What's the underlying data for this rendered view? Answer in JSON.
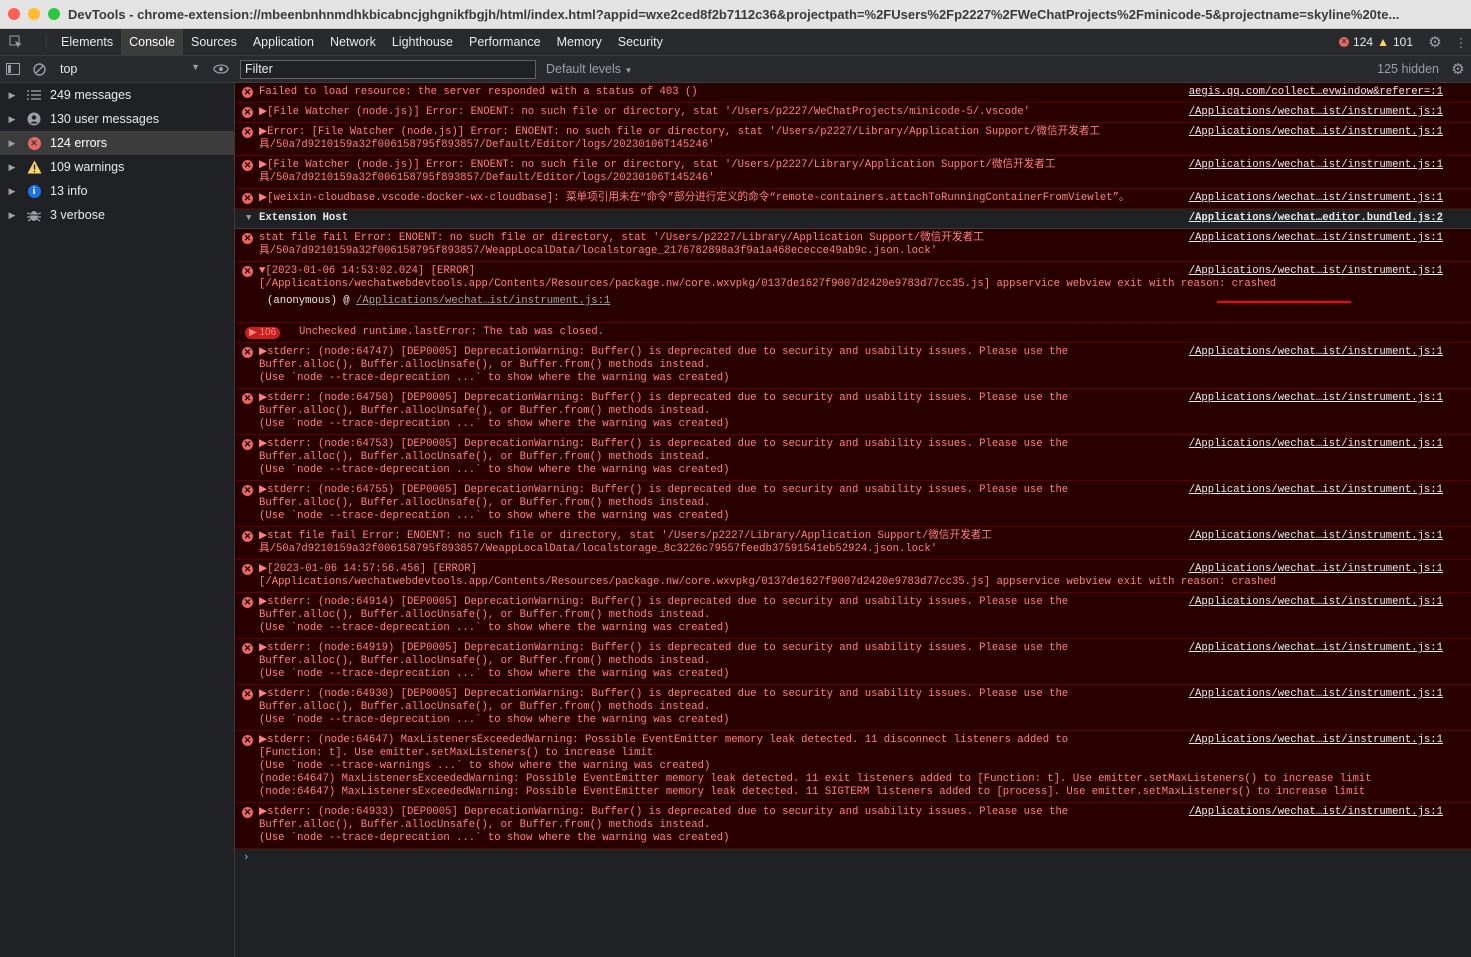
{
  "window": {
    "title": "DevTools - chrome-extension://mbeenbnhnmdhkbicabncjghgnikfbgjh/html/index.html?appid=wxe2ced8f2b7112c36&projectpath=%2FUsers%2Fp2227%2FWeChatProjects%2Fminicode-5&projectname=skyline%20te..."
  },
  "tabs": [
    "Elements",
    "Console",
    "Sources",
    "Application",
    "Network",
    "Lighthouse",
    "Performance",
    "Memory",
    "Security"
  ],
  "status": {
    "errors": "124",
    "warnings": "101"
  },
  "toolbar": {
    "context": "top",
    "filter_placeholder": "Filter",
    "levels": "Default levels",
    "hidden": "125 hidden"
  },
  "sidebar": [
    {
      "label": "249 messages",
      "icon": "list-icon"
    },
    {
      "label": "130 user messages",
      "icon": "user-icon"
    },
    {
      "label": "124 errors",
      "icon": "error-icon"
    },
    {
      "label": "109 warnings",
      "icon": "warning-icon"
    },
    {
      "label": "13 info",
      "icon": "info-icon"
    },
    {
      "label": "3 verbose",
      "icon": "bug-icon"
    }
  ],
  "messages": [
    {
      "text": "Failed to load resource: the server responded with a status of 403 ()",
      "source": "aegis.qq.com/collect…evwindow&referer=:1"
    },
    {
      "text": "▶[File Watcher (node.js)] Error: ENOENT: no such file or directory, stat '/Users/p2227/WeChatProjects/minicode-5/.vscode'",
      "source": "/Applications/wechat…ist/instrument.js:1"
    },
    {
      "text": "▶Error: [File Watcher (node.js)] Error: ENOENT: no such file or directory, stat '/Users/p2227/Library/Application Support/微信开发者工\n具/50a7d9210159a32f006158795f893857/Default/Editor/logs/20230106T145246'",
      "source": "/Applications/wechat…ist/instrument.js:1"
    },
    {
      "text": "▶[File Watcher (node.js)] Error: ENOENT: no such file or directory, stat '/Users/p2227/Library/Application Support/微信开发者工\n具/50a7d9210159a32f006158795f893857/Default/Editor/logs/20230106T145246'",
      "source": "/Applications/wechat…ist/instrument.js:1"
    },
    {
      "text": "▶[weixin-cloudbase.vscode-docker-wx-cloudbase]: 菜单项引用未在“命令”部分进行定义的命令“remote-containers.attachToRunningContainerFromViewlet”。",
      "source": "/Applications/wechat…ist/instrument.js:1"
    }
  ],
  "group": {
    "label": "Extension Host",
    "source": "/Applications/wechat…editor.bundled.js:2"
  },
  "group_messages": [
    {
      "text": "stat file fail Error: ENOENT: no such file or directory, stat '/Users/p2227/Library/Application Support/微信开发者工\n具/50a7d9210159a32f006158795f893857/WeappLocalData/localstorage_2176782898a3f9a1a468ececce49ab9c.json.lock'",
      "source": "/Applications/wechat…ist/instrument.js:1"
    },
    {
      "text": "▼[2023-01-06 14:53:02.024] [ERROR]\n[/Applications/wechatwebdevtools.app/Contents/Resources/package.nw/core.wxvpkg/0137de1627f9007d2420e9783d77cc35.js] appservice webview exit with reason: crashed",
      "source": "/Applications/wechat…ist/instrument.js:1",
      "stack_prefix": "(anonymous) @ ",
      "stack_link": "/Applications/wechat…ist/instrument.js:1"
    }
  ],
  "repeat": {
    "count": "106",
    "text": "Unchecked runtime.lastError: The tab was closed."
  },
  "messages2": [
    {
      "text": "▶stderr: (node:64747) [DEP0005] DeprecationWarning: Buffer() is deprecated due to security and usability issues. Please use the\nBuffer.alloc(), Buffer.allocUnsafe(), or Buffer.from() methods instead.\n(Use `node --trace-deprecation ...` to show where the warning was created)",
      "source": "/Applications/wechat…ist/instrument.js:1"
    },
    {
      "text": "▶stderr: (node:64750) [DEP0005] DeprecationWarning: Buffer() is deprecated due to security and usability issues. Please use the\nBuffer.alloc(), Buffer.allocUnsafe(), or Buffer.from() methods instead.\n(Use `node --trace-deprecation ...` to show where the warning was created)",
      "source": "/Applications/wechat…ist/instrument.js:1"
    },
    {
      "text": "▶stderr: (node:64753) [DEP0005] DeprecationWarning: Buffer() is deprecated due to security and usability issues. Please use the\nBuffer.alloc(), Buffer.allocUnsafe(), or Buffer.from() methods instead.\n(Use `node --trace-deprecation ...` to show where the warning was created)",
      "source": "/Applications/wechat…ist/instrument.js:1"
    },
    {
      "text": "▶stderr: (node:64755) [DEP0005] DeprecationWarning: Buffer() is deprecated due to security and usability issues. Please use the\nBuffer.alloc(), Buffer.allocUnsafe(), or Buffer.from() methods instead.\n(Use `node --trace-deprecation ...` to show where the warning was created)",
      "source": "/Applications/wechat…ist/instrument.js:1"
    },
    {
      "text": "▶stat file fail Error: ENOENT: no such file or directory, stat '/Users/p2227/Library/Application Support/微信开发者工\n具/50a7d9210159a32f006158795f893857/WeappLocalData/localstorage_8c3226c79557feedb37591541eb52924.json.lock'",
      "source": "/Applications/wechat…ist/instrument.js:1"
    },
    {
      "text": "▶[2023-01-06 14:57:56.456] [ERROR]\n[/Applications/wechatwebdevtools.app/Contents/Resources/package.nw/core.wxvpkg/0137de1627f9007d2420e9783d77cc35.js] appservice webview exit with reason: crashed",
      "source": "/Applications/wechat…ist/instrument.js:1"
    },
    {
      "text": "▶stderr: (node:64914) [DEP0005] DeprecationWarning: Buffer() is deprecated due to security and usability issues. Please use the\nBuffer.alloc(), Buffer.allocUnsafe(), or Buffer.from() methods instead.\n(Use `node --trace-deprecation ...` to show where the warning was created)",
      "source": "/Applications/wechat…ist/instrument.js:1"
    },
    {
      "text": "▶stderr: (node:64919) [DEP0005] DeprecationWarning: Buffer() is deprecated due to security and usability issues. Please use the\nBuffer.alloc(), Buffer.allocUnsafe(), or Buffer.from() methods instead.\n(Use `node --trace-deprecation ...` to show where the warning was created)",
      "source": "/Applications/wechat…ist/instrument.js:1"
    },
    {
      "text": "▶stderr: (node:64930) [DEP0005] DeprecationWarning: Buffer() is deprecated due to security and usability issues. Please use the\nBuffer.alloc(), Buffer.allocUnsafe(), or Buffer.from() methods instead.\n(Use `node --trace-deprecation ...` to show where the warning was created)",
      "source": "/Applications/wechat…ist/instrument.js:1"
    },
    {
      "text": "▶stderr: (node:64647) MaxListenersExceededWarning: Possible EventEmitter memory leak detected. 11 disconnect listeners added to\n[Function: t]. Use emitter.setMaxListeners() to increase limit\n(Use `node --trace-warnings ...` to show where the warning was created)\n(node:64647) MaxListenersExceededWarning: Possible EventEmitter memory leak detected. 11 exit listeners added to [Function: t]. Use emitter.setMaxListeners() to increase limit\n(node:64647) MaxListenersExceededWarning: Possible EventEmitter memory leak detected. 11 SIGTERM listeners added to [process]. Use emitter.setMaxListeners() to increase limit",
      "source": "/Applications/wechat…ist/instrument.js:1"
    },
    {
      "text": "▶stderr: (node:64933) [DEP0005] DeprecationWarning: Buffer() is deprecated due to security and usability issues. Please use the\nBuffer.alloc(), Buffer.allocUnsafe(), or Buffer.from() methods instead.\n(Use `node --trace-deprecation ...` to show where the warning was created)",
      "source": "/Applications/wechat…ist/instrument.js:1"
    }
  ],
  "colors": {
    "error_bg": "#290000",
    "error_text": "#ff8080",
    "accent": "#8ab4f8",
    "annotation": "#ff0000"
  }
}
